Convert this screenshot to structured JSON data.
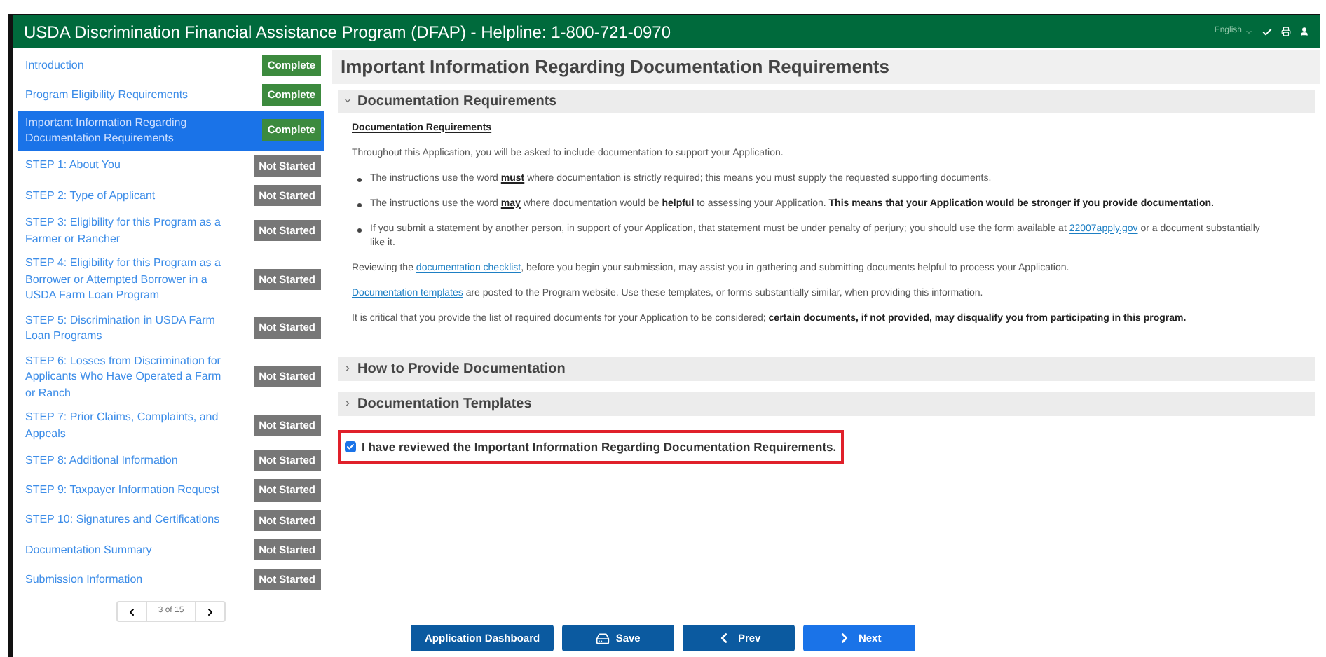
{
  "header": {
    "title": "USDA Discrimination Financial Assistance Program (DFAP) - Helpline: 1-800-721-0970",
    "language": "English"
  },
  "sidebar": {
    "items": [
      {
        "label": "Introduction",
        "status": "Complete",
        "kind": "complete",
        "selected": false
      },
      {
        "label": "Program Eligibility Requirements",
        "status": "Complete",
        "kind": "complete",
        "selected": false
      },
      {
        "label": "Important Information Regarding Documentation Requirements",
        "status": "Complete",
        "kind": "complete",
        "selected": true
      },
      {
        "label": "STEP 1: About You",
        "status": "Not Started",
        "kind": "not_started",
        "selected": false
      },
      {
        "label": "STEP 2: Type of Applicant",
        "status": "Not Started",
        "kind": "not_started",
        "selected": false
      },
      {
        "label": "STEP 3: Eligibility for this Program as a Farmer or Rancher",
        "status": "Not Started",
        "kind": "not_started",
        "selected": false
      },
      {
        "label": "STEP 4: Eligibility for this Program as a Borrower or Attempted Borrower in a USDA Farm Loan Program",
        "status": "Not Started",
        "kind": "not_started",
        "selected": false
      },
      {
        "label": "STEP 5: Discrimination in USDA Farm Loan Programs",
        "status": "Not Started",
        "kind": "not_started",
        "selected": false
      },
      {
        "label": "STEP 6: Losses from Discrimination for Applicants Who Have Operated a Farm or Ranch",
        "status": "Not Started",
        "kind": "not_started",
        "selected": false
      },
      {
        "label": "STEP 7: Prior Claims, Complaints, and Appeals",
        "status": "Not Started",
        "kind": "not_started",
        "selected": false
      },
      {
        "label": "STEP 8: Additional Information",
        "status": "Not Started",
        "kind": "not_started",
        "selected": false
      },
      {
        "label": "STEP 9: Taxpayer Information Request",
        "status": "Not Started",
        "kind": "not_started",
        "selected": false
      },
      {
        "label": "STEP 10: Signatures and Certifications",
        "status": "Not Started",
        "kind": "not_started",
        "selected": false
      },
      {
        "label": "Documentation Summary",
        "status": "Not Started",
        "kind": "not_started",
        "selected": false
      },
      {
        "label": "Submission Information",
        "status": "Not Started",
        "kind": "not_started",
        "selected": false
      }
    ],
    "pager": "3 of 15"
  },
  "main": {
    "title": "Important Information Regarding Documentation Requirements",
    "sections": [
      {
        "title": "Documentation Requirements",
        "expanded": true,
        "heading": "Documentation Requirements",
        "blocks": [
          {
            "kind": "paragraph",
            "parts": [
              {
                "kind": "text",
                "text": "Throughout this Application, you will be asked to include documentation to support your Application."
              }
            ]
          },
          {
            "kind": "bullet",
            "parts": [
              {
                "kind": "text",
                "text": "The instructions use the word *must* where documentation is strictly required; this means you must supply the requested supporting documents."
              }
            ]
          },
          {
            "kind": "bullet",
            "parts": [
              {
                "kind": "text",
                "text": "The instructions use the word *may* where documentation would be **helpful** to assessing your Application. **This means that your Application would be stronger if you provide documentation.**"
              }
            ]
          },
          {
            "kind": "bullet",
            "parts": [
              {
                "kind": "text",
                "text": "If you submit a statement by another person, in support of your Application, that statement must be under penalty of perjury; you should use the form available at "
              },
              {
                "kind": "link",
                "text": "22007apply.gov"
              },
              {
                "kind": "text",
                "text": " or a document substantially like it."
              }
            ]
          },
          {
            "kind": "paragraph",
            "parts": [
              {
                "kind": "text",
                "text": "Reviewing the "
              },
              {
                "kind": "link",
                "text": "documentation checklist"
              },
              {
                "kind": "text",
                "text": ", before you begin your submission, may assist you in gathering and submitting documents helpful to process your Application."
              }
            ]
          },
          {
            "kind": "paragraph",
            "parts": [
              {
                "kind": "link",
                "text": "Documentation templates"
              },
              {
                "kind": "text",
                "text": " are posted to the Program website. Use these templates, or forms substantially similar, when providing this information."
              }
            ]
          },
          {
            "kind": "paragraph",
            "parts": [
              {
                "kind": "text",
                "text": "It is critical that you provide the list of required documents for your Application to be considered; **certain documents, if not provided, may disqualify you from participating in this program.**"
              }
            ]
          }
        ]
      },
      {
        "title": "How to Provide Documentation",
        "expanded": false
      },
      {
        "title": "Documentation Templates",
        "expanded": false
      }
    ],
    "acknowledgement": {
      "label": "I have reviewed the Important Information Regarding Documentation Requirements.",
      "checked": true,
      "highlighted": true
    }
  },
  "buttons": [
    {
      "label": "Application Dashboard",
      "kind": "plain"
    },
    {
      "label": "Save",
      "kind": "save"
    },
    {
      "label": "Prev",
      "kind": "prev"
    },
    {
      "label": "Next",
      "kind": "next"
    }
  ]
}
